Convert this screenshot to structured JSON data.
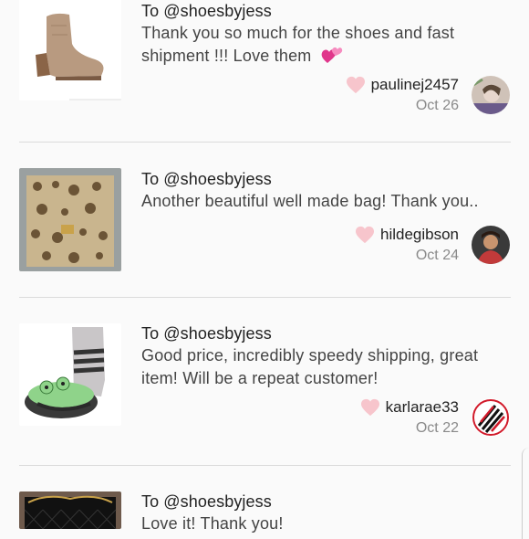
{
  "reviews": [
    {
      "to": "To @shoesbyjess",
      "message": "Thank you so much for the shoes and fast shipment !!! Love them",
      "emoji": "two-hearts",
      "username": "paulinej2457",
      "date": "Oct 26",
      "item": "ankle-boot"
    },
    {
      "to": "To @shoesbyjess",
      "message": "Another beautiful well made bag! Thank you..",
      "username": "hildegibson",
      "date": "Oct 24",
      "item": "snakeskin-bag"
    },
    {
      "to": "To @shoesbyjess",
      "message": "Good price, incredibly speedy shipping, great item! Will be a repeat customer!",
      "username": "karlarae33",
      "date": "Oct 22",
      "item": "frog-slipper-sock"
    },
    {
      "to": "To @shoesbyjess",
      "message": "Love it! Thank you!",
      "item": "quilted-chain-bag"
    }
  ],
  "colors": {
    "heart": "#f7c5cc",
    "divider": "#dcdcdc",
    "date": "#8a8a8a"
  }
}
